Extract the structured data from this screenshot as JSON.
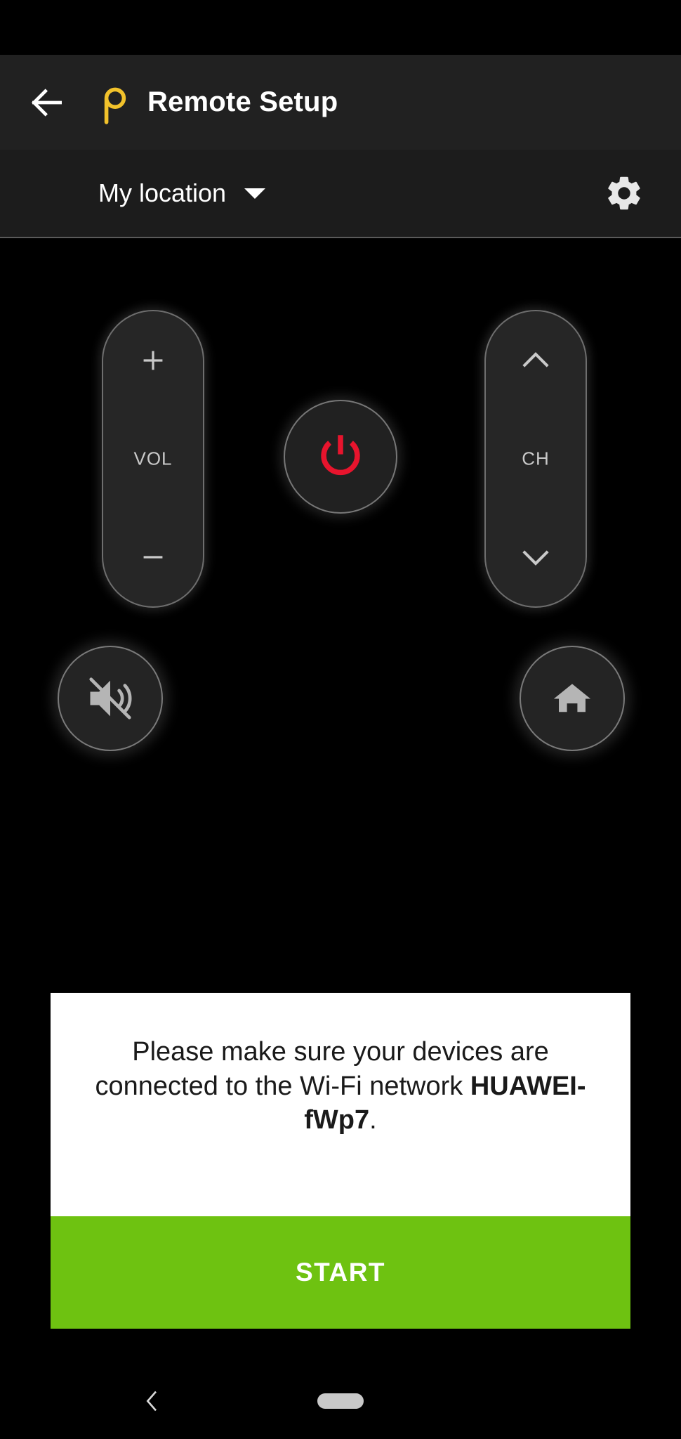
{
  "app": {
    "title": "Remote Setup",
    "logo_icon": "peel-p-logo-icon",
    "logo_color": "#f2c22b",
    "back_icon": "arrow-left-icon"
  },
  "location_bar": {
    "location_label": "My location",
    "caret_icon": "caret-down-icon",
    "settings_icon": "gear-icon"
  },
  "remote": {
    "volume": {
      "up_icon": "plus-icon",
      "up_label": "+",
      "label": "VOL",
      "down_icon": "minus-icon",
      "down_label": "—"
    },
    "channel": {
      "up_icon": "chevron-up-icon",
      "label": "CH",
      "down_icon": "chevron-down-icon"
    },
    "power": {
      "icon": "power-icon",
      "color": "#e8142d"
    },
    "mute": {
      "icon": "volume-mute-icon"
    },
    "home": {
      "icon": "home-icon"
    }
  },
  "dialog": {
    "message_prefix": "Please make sure your devices are connected to the Wi-Fi network ",
    "network_name": "HUAWEI-fWp7",
    "message_suffix": ".",
    "start_label": "START",
    "start_color": "#6ec211"
  },
  "bottom_nav": {
    "back_icon": "nav-back-chevron-icon",
    "home_icon": "nav-home-pill-icon"
  }
}
